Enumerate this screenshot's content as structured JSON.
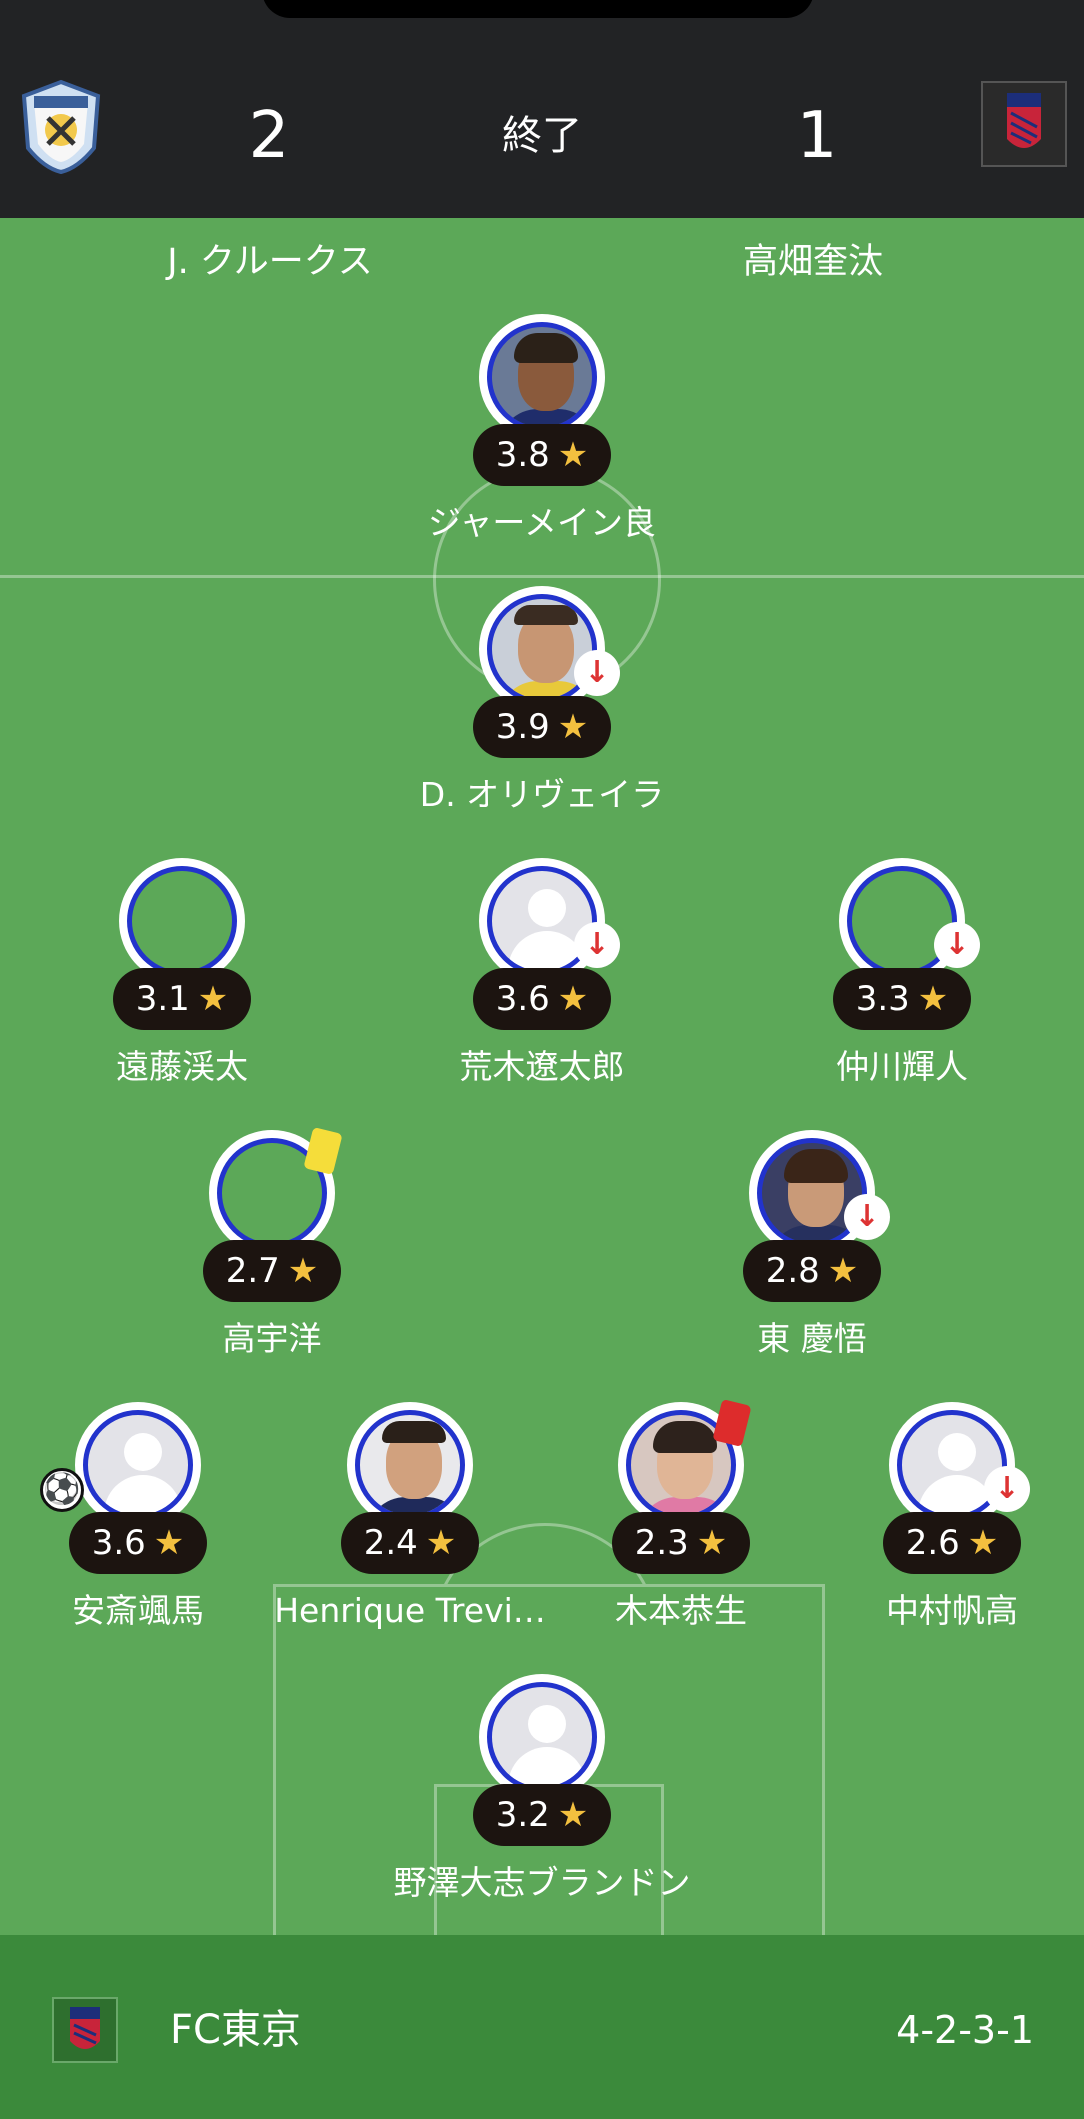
{
  "header": {
    "home_score": "2",
    "status": "終了",
    "away_score": "1",
    "home_logo_icon": "jubilo-iwata-crest-icon",
    "away_logo_icon": "fc-tokyo-crest-icon"
  },
  "top_names": {
    "left": "J. クルークス",
    "right": "高畑奎汰"
  },
  "players": {
    "p1": {
      "name": "ジャーメイン良",
      "rating": "3.8"
    },
    "p2": {
      "name": "D. オリヴェイラ",
      "rating": "3.9"
    },
    "p3": {
      "name": "遠藤渓太",
      "rating": "3.1"
    },
    "p4": {
      "name": "荒木遼太郎",
      "rating": "3.6"
    },
    "p5": {
      "name": "仲川輝人",
      "rating": "3.3"
    },
    "p6": {
      "name": "高宇洋",
      "rating": "2.7"
    },
    "p7": {
      "name": "東 慶悟",
      "rating": "2.8"
    },
    "p8": {
      "name": "安斎颯馬",
      "rating": "3.6"
    },
    "p9": {
      "name": "Henrique Trevi…",
      "rating": "2.4"
    },
    "p10": {
      "name": "木本恭生",
      "rating": "2.3"
    },
    "p11": {
      "name": "中村帆高",
      "rating": "2.6"
    },
    "p12": {
      "name": "野澤大志ブランドン",
      "rating": "3.2"
    }
  },
  "icons": {
    "star": "★",
    "sub_out": "↓",
    "goal": "⚽"
  },
  "colors": {
    "pitch": "#5ca858",
    "header": "#222325",
    "footer": "#3b8a3b",
    "star": "#f3c03f",
    "ring": "#2233cc",
    "yellow_card": "#f5dd3a",
    "red_card": "#dd2c2c"
  },
  "footer": {
    "team_name": "FC東京",
    "formation": "4-2-3-1"
  }
}
